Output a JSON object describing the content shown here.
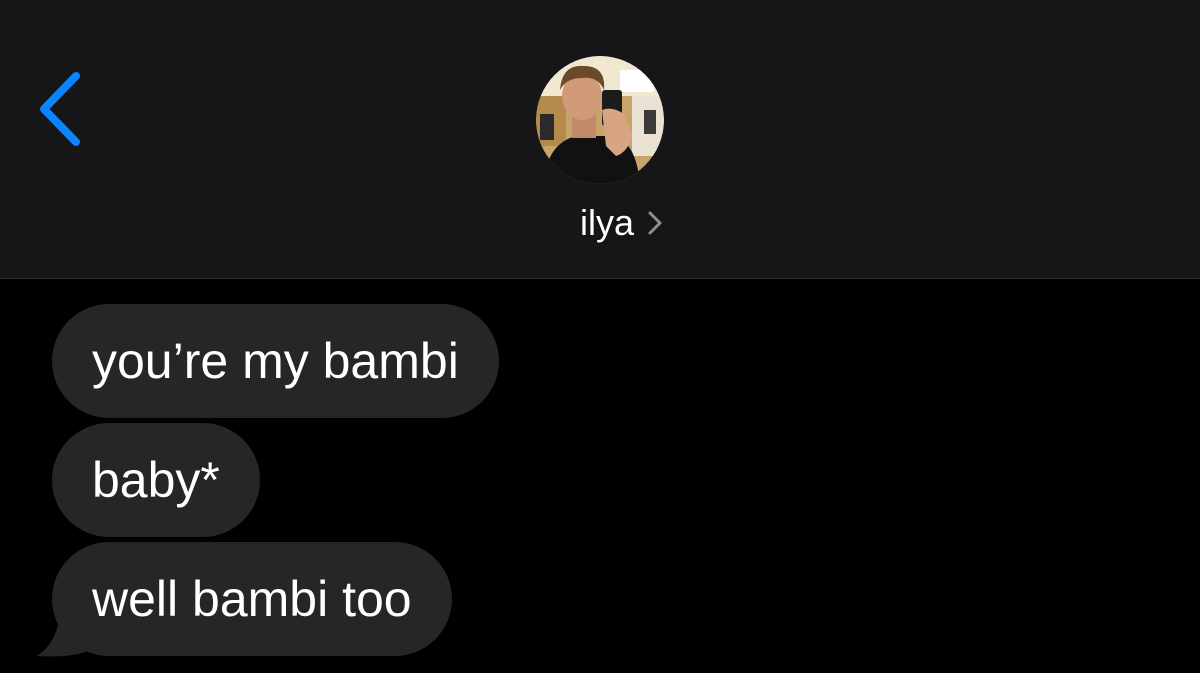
{
  "header": {
    "back_icon": "chevron-left-icon",
    "contact_name": "ilya",
    "contact_chevron_icon": "chevron-right-icon",
    "accent_color": "#0a84ff"
  },
  "messages": [
    {
      "direction": "incoming",
      "text": "you’re my bambi"
    },
    {
      "direction": "incoming",
      "text": "baby*"
    },
    {
      "direction": "incoming",
      "text": "well bambi too"
    }
  ],
  "colors": {
    "header_background": "#161618",
    "thread_background": "#000000",
    "incoming_bubble": "#262628",
    "text": "#ffffff"
  }
}
